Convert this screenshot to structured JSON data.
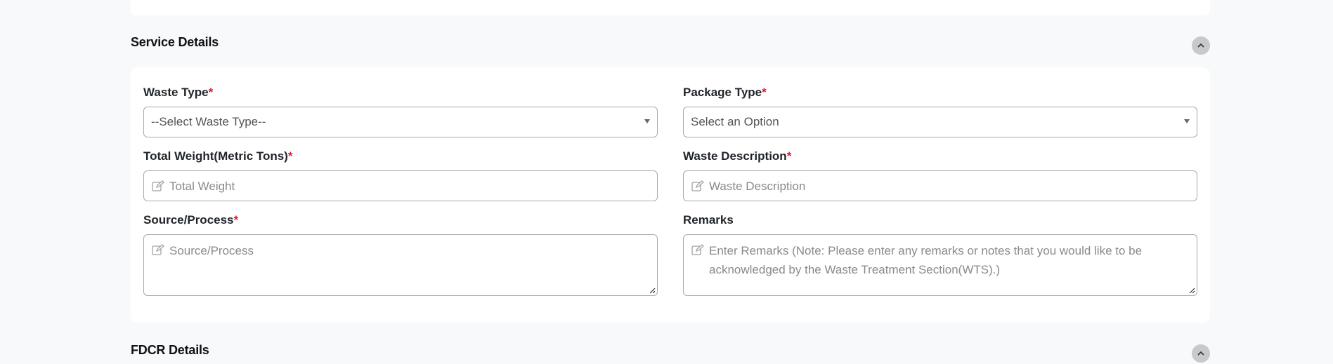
{
  "sections": {
    "service": {
      "title": "Service Details"
    },
    "fdcr": {
      "title": "FDCR Details"
    }
  },
  "form": {
    "waste_type": {
      "label": "Waste Type",
      "required": "*",
      "value": "--Select Waste Type--"
    },
    "package_type": {
      "label": "Package Type",
      "required": "*",
      "value": "Select an Option"
    },
    "total_weight": {
      "label": "Total Weight(Metric Tons)",
      "required": "*",
      "placeholder": "Total Weight"
    },
    "waste_description": {
      "label": "Waste Description",
      "required": "*",
      "placeholder": "Waste Description"
    },
    "source_process": {
      "label": "Source/Process",
      "required": "*",
      "placeholder": "Source/Process"
    },
    "remarks": {
      "label": "Remarks",
      "placeholder": "Enter Remarks (Note: Please enter any remarks or notes that you would like to be acknowledged by the Waste Treatment Section(WTS).)"
    }
  },
  "icons": {
    "collapse": "chevron-up-icon",
    "field_edit": "edit-icon",
    "select_caret": "caret-down-icon"
  },
  "colors": {
    "page_bg": "#f8f9fb",
    "card_bg": "#ffffff",
    "required": "#e0182d",
    "border": "#a9a9a9",
    "collapse_btn": "#c9c9c9"
  }
}
